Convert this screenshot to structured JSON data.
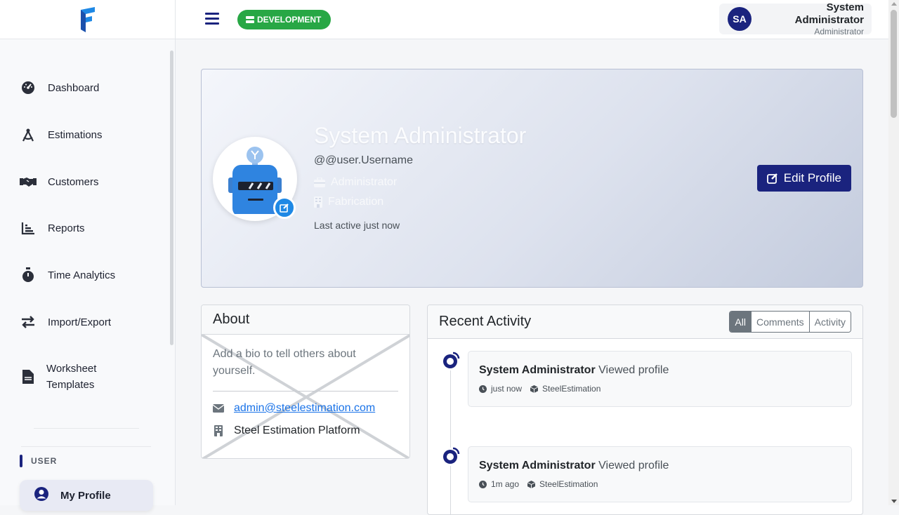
{
  "sidebar": {
    "items": [
      {
        "label": "Dashboard",
        "icon": "gauge-icon"
      },
      {
        "label": "Estimations",
        "icon": "drafting-compass-icon"
      },
      {
        "label": "Customers",
        "icon": "handshake-icon"
      },
      {
        "label": "Reports",
        "icon": "bar-chart-icon"
      },
      {
        "label": "Time Analytics",
        "icon": "stopwatch-icon"
      },
      {
        "label": "Import/Export",
        "icon": "swap-arrows-icon"
      },
      {
        "label": "Worksheet Templates",
        "icon": "file-icon"
      }
    ],
    "section_user": "USER",
    "active_item": {
      "label": "My Profile",
      "icon": "user-circle-icon"
    }
  },
  "topbar": {
    "env_label": "DEVELOPMENT",
    "user_initials": "SA",
    "user_name": "System Administrator",
    "user_role": "Administrator"
  },
  "profile": {
    "name": "System Administrator",
    "handle": "@@user.Username",
    "role": "Administrator",
    "department": "Fabrication",
    "last_active": "Last active just now",
    "edit_label": "Edit Profile"
  },
  "about": {
    "title": "About",
    "bio": "Add a bio to tell others about yourself.",
    "email": "admin@steelestimation.com",
    "company": "Steel Estimation Platform"
  },
  "activity": {
    "title": "Recent Activity",
    "filters": [
      "All",
      "Comments",
      "Activity"
    ],
    "active_filter": "All",
    "items": [
      {
        "user": "System Administrator",
        "action": "Viewed profile",
        "time": "just now",
        "module": "SteelEstimation"
      },
      {
        "user": "System Administrator",
        "action": "Viewed profile",
        "time": "1m ago",
        "module": "SteelEstimation"
      }
    ]
  },
  "colors": {
    "primary": "#1a237e",
    "success": "#28a745",
    "accent": "#1e88e5"
  }
}
